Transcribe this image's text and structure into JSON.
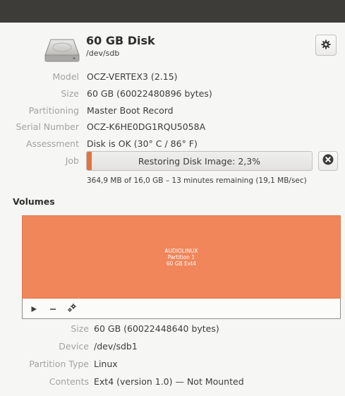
{
  "disk": {
    "name": "60 GB Disk",
    "path": "/dev/sdb",
    "icon": "harddisk-icon",
    "menu_icon": "gear-icon"
  },
  "properties": [
    {
      "label": "Model",
      "value": "OCZ-VERTEX3 (2.15)"
    },
    {
      "label": "Size",
      "value": "60 GB (60022480896 bytes)"
    },
    {
      "label": "Partitioning",
      "value": "Master Boot Record"
    },
    {
      "label": "Serial Number",
      "value": "OCZ-K6HE0DG1RQU5058A"
    },
    {
      "label": "Assessment",
      "value": "Disk is OK (30° C / 86° F)"
    }
  ],
  "job": {
    "label": "Job",
    "text": "Restoring Disk Image: 2,3%",
    "progress": 0.023,
    "detail": "364,9 MB of 16,0 GB – 13 minutes remaining (19,1 MB/sec)",
    "cancel_icon": "cancel-icon"
  },
  "volumes": {
    "heading": "Volumes",
    "partition": {
      "label": "AUDIOLINUX",
      "number": "Partition 1",
      "info": "60 GB Ext4"
    },
    "toolbar": {
      "mount_icon": "play-icon",
      "delete_icon": "minus-icon",
      "options_icon": "gears-icon"
    },
    "details": [
      {
        "label": "Size",
        "value": "60 GB (60022448640 bytes)"
      },
      {
        "label": "Device",
        "value": "/dev/sdb1"
      },
      {
        "label": "Partition Type",
        "value": "Linux"
      },
      {
        "label": "Contents",
        "value": "Ext4 (version 1.0) — Not Mounted"
      }
    ]
  },
  "colors": {
    "accent": "#f0865a",
    "progress": "#e0733f",
    "label": "#a3a3a1",
    "titlebar": "#3d3c38"
  }
}
